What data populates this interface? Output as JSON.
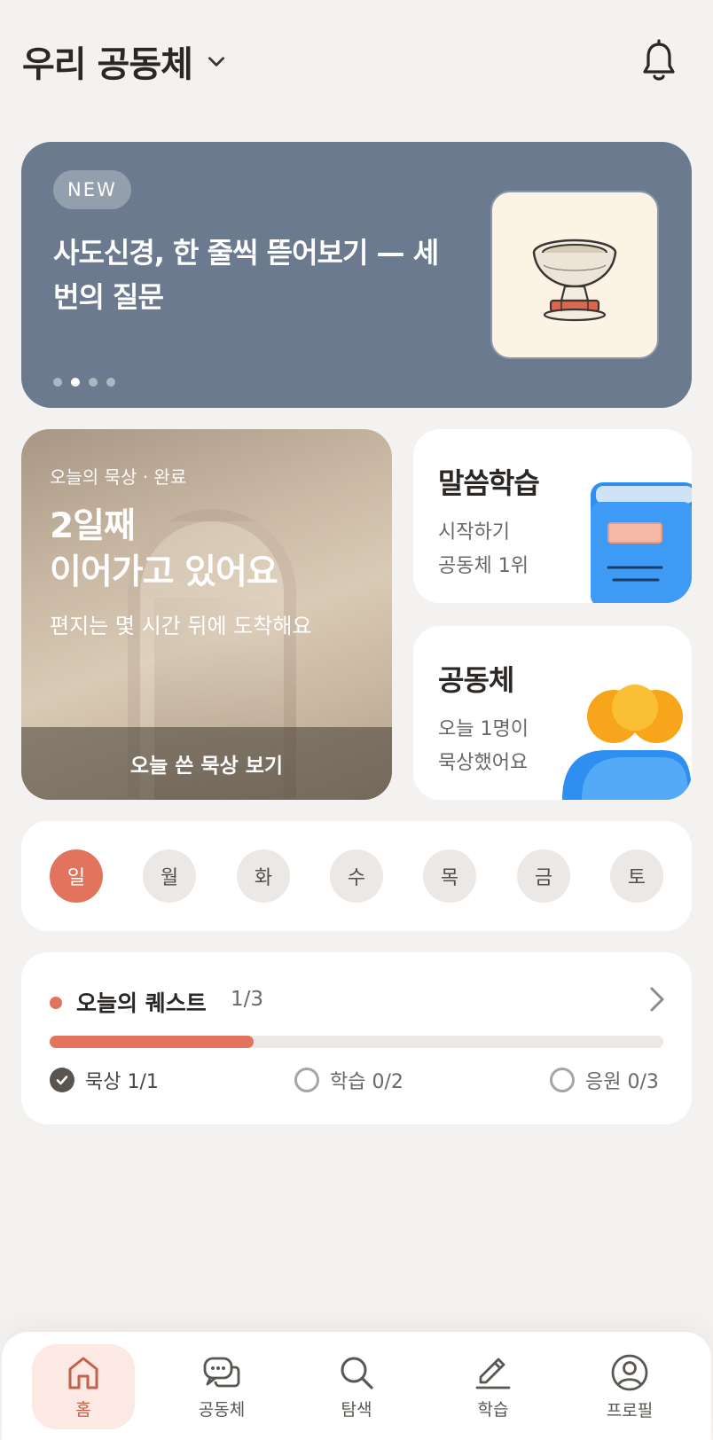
{
  "header": {
    "title": "우리 공동체",
    "icons": {
      "dropdown": "chevron-down-icon",
      "notification": "bell-icon"
    }
  },
  "banner": {
    "badge": "NEW",
    "title": "사도신경, 한 줄씩 뜯어보기 — 세 번의 질문",
    "image": "stone-font-illustration",
    "page_count": 4,
    "active_page": 2
  },
  "meditation": {
    "kicker": "오늘의 묵상 · 완료",
    "title_line1": "2일째",
    "title_line2": "이어가고 있어요",
    "subtitle": "편지는 몇 시간 뒤에 도착해요",
    "action": "오늘 쓴 묵상 보기"
  },
  "study_card": {
    "title": "말씀학습",
    "line1": "시작하기",
    "line2": "공동체 1위",
    "icon": "book-icon"
  },
  "community_card": {
    "title": "공동체",
    "line1": "오늘 1명이",
    "line2": "묵상했어요",
    "icon": "people-icon"
  },
  "week": {
    "days": [
      "일",
      "월",
      "화",
      "수",
      "목",
      "금",
      "토"
    ],
    "active_index": 0
  },
  "quest": {
    "title": "오늘의 퀘스트",
    "count": "1/3",
    "progress": 0.333,
    "items": [
      {
        "label": "묵상 1/1",
        "done": true
      },
      {
        "label": "학습 0/2",
        "done": false
      },
      {
        "label": "응원 0/3",
        "done": false
      }
    ]
  },
  "nav": {
    "items": [
      {
        "label": "홈",
        "icon": "home-icon"
      },
      {
        "label": "공동체",
        "icon": "chat-bubbles-icon"
      },
      {
        "label": "탐색",
        "icon": "search-icon"
      },
      {
        "label": "학습",
        "icon": "pencil-icon"
      },
      {
        "label": "프로필",
        "icon": "profile-icon"
      }
    ],
    "active_index": 0
  },
  "colors": {
    "accent": "#e2735c",
    "banner_bg": "#6b7a8e",
    "background": "#f4f2f0",
    "nav_active_bg": "#fde9e3"
  }
}
